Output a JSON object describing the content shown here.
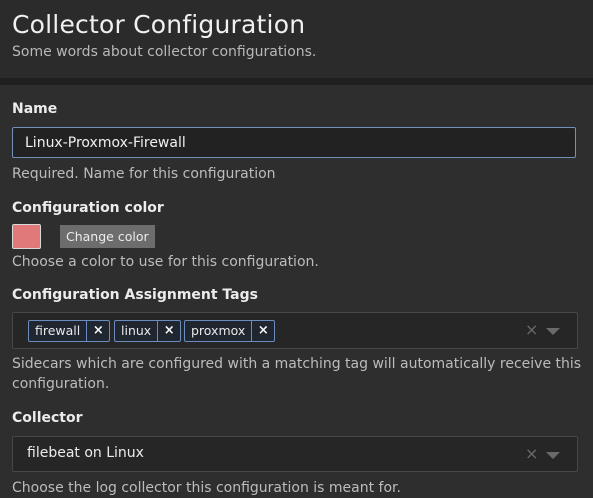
{
  "header": {
    "title": "Collector Configuration",
    "subtitle": "Some words about collector configurations."
  },
  "form": {
    "name": {
      "label": "Name",
      "value": "Linux-Proxmox-Firewall",
      "help": "Required. Name for this configuration"
    },
    "color": {
      "label": "Configuration color",
      "swatch_color": "#e07a7a",
      "change_label": "Change color",
      "help": "Choose a color to use for this configuration."
    },
    "tags": {
      "label": "Configuration Assignment Tags",
      "items": [
        {
          "label": "firewall",
          "remove": "×"
        },
        {
          "label": "linux",
          "remove": "×"
        },
        {
          "label": "proxmox",
          "remove": "×"
        }
      ],
      "clear": "×",
      "help_line1": "Sidecars which are configured with a matching tag will automatically receive this",
      "help_line2": "configuration."
    },
    "collector": {
      "label": "Collector",
      "value": "filebeat on Linux",
      "clear": "×",
      "help": "Choose the log collector this configuration is meant for."
    }
  }
}
